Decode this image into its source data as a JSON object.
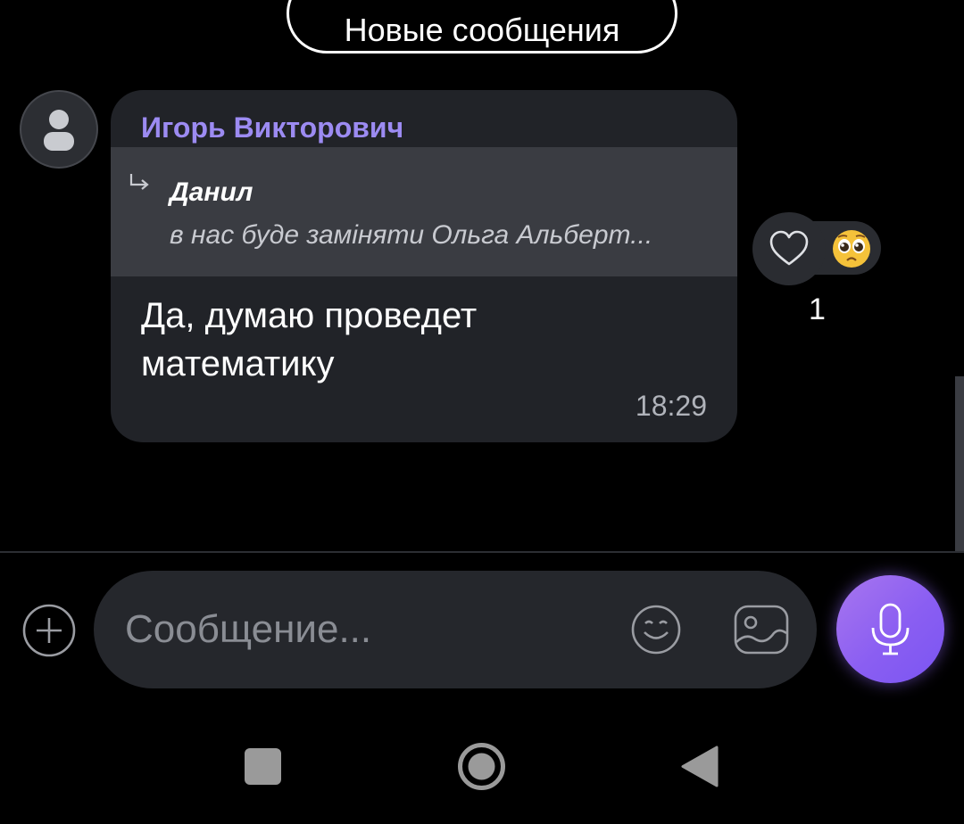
{
  "banner": {
    "new_messages_label": "Новые сообщения"
  },
  "message": {
    "sender": "Игорь Викторович",
    "reply": {
      "author": "Данил",
      "text": "в нас буде заміняти Ольга Альберт..."
    },
    "text": "Да, думаю проведет математику",
    "time": "18:29",
    "reactions": {
      "emoji_icon": "pleading-face-emoji",
      "count": "1"
    }
  },
  "composer": {
    "placeholder": "Сообщение..."
  },
  "colors": {
    "accent": "#9c8bf2",
    "bubble": "#212328",
    "mic_gradient_start": "#a876ee",
    "mic_gradient_end": "#7b55f3"
  }
}
